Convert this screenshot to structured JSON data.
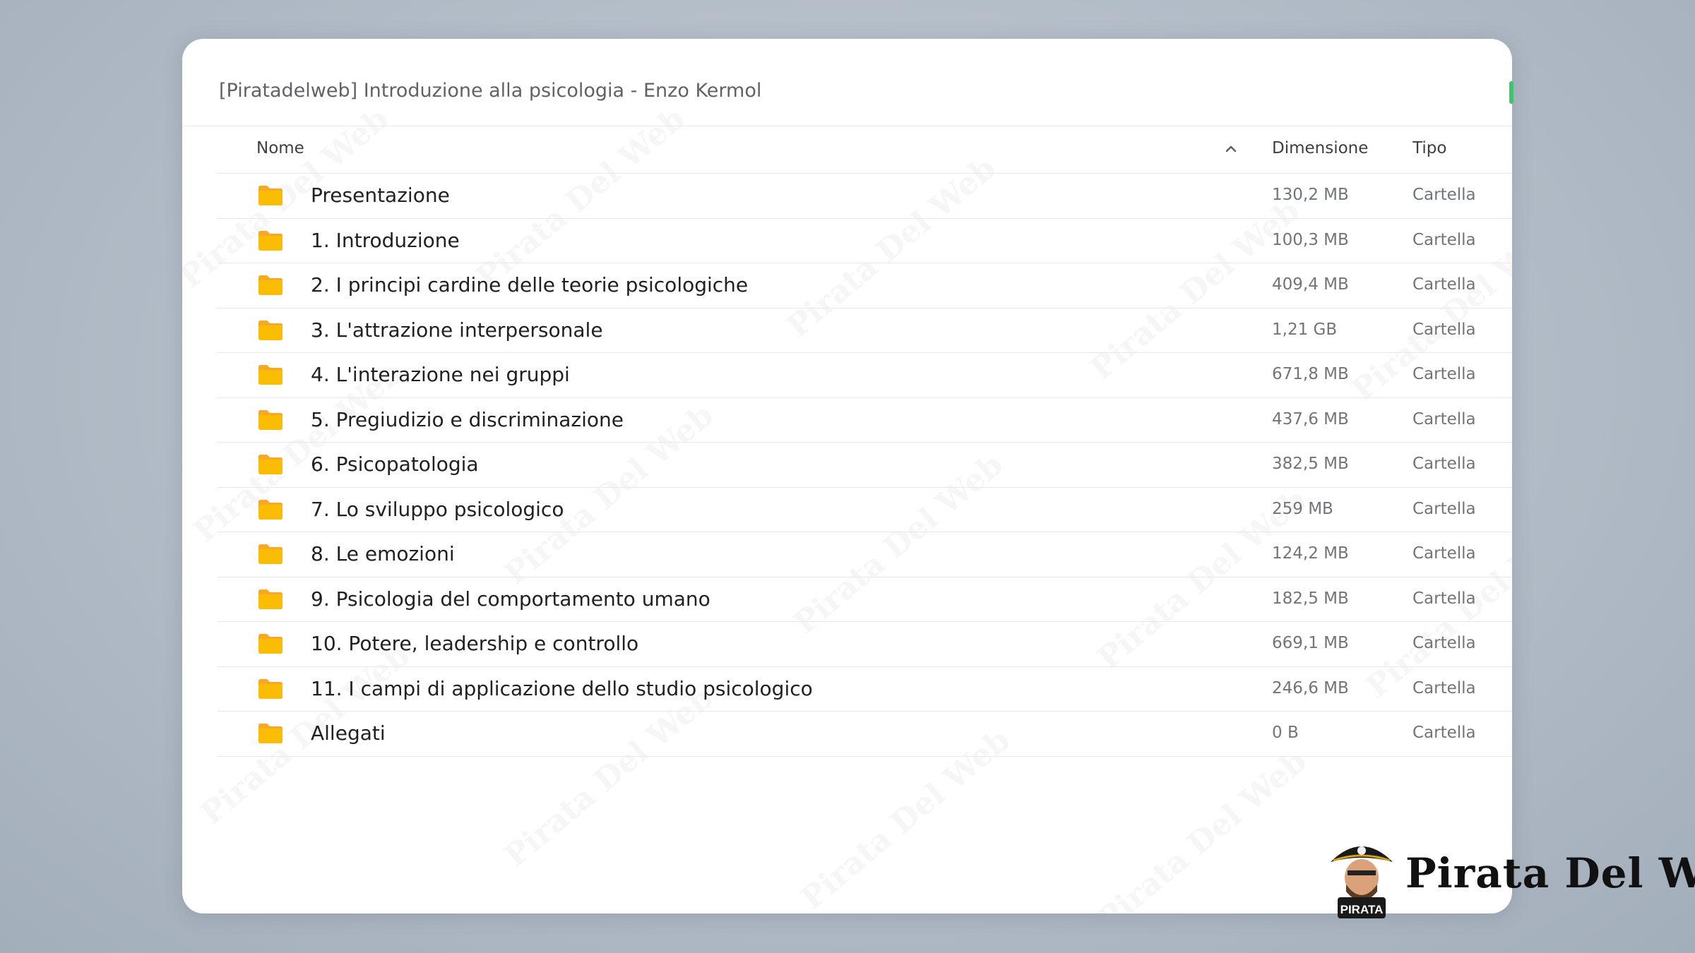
{
  "window": {
    "title": "[Piratadelweb] Introduzione alla psicologia - Enzo Kermol"
  },
  "columns": {
    "name": "Nome",
    "size": "Dimensione",
    "type": "Tipo",
    "sort_icon": "chevron-up-icon"
  },
  "files": [
    {
      "name": "Presentazione",
      "size": "130,2 MB",
      "type": "Cartella"
    },
    {
      "name": "1. Introduzione",
      "size": "100,3 MB",
      "type": "Cartella"
    },
    {
      "name": "2. I principi cardine delle teorie psicologiche",
      "size": "409,4 MB",
      "type": "Cartella"
    },
    {
      "name": "3. L'attrazione interpersonale",
      "size": "1,21 GB",
      "type": "Cartella"
    },
    {
      "name": "4. L'interazione nei gruppi",
      "size": "671,8 MB",
      "type": "Cartella"
    },
    {
      "name": "5. Pregiudizio e discriminazione",
      "size": "437,6 MB",
      "type": "Cartella"
    },
    {
      "name": "6. Psicopatologia",
      "size": "382,5 MB",
      "type": "Cartella"
    },
    {
      "name": "7. Lo sviluppo psicologico",
      "size": "259 MB",
      "type": "Cartella"
    },
    {
      "name": "8. Le emozioni",
      "size": "124,2 MB",
      "type": "Cartella"
    },
    {
      "name": "9. Psicologia del comportamento umano",
      "size": "182,5 MB",
      "type": "Cartella"
    },
    {
      "name": "10. Potere, leadership e controllo",
      "size": "669,1 MB",
      "type": "Cartella"
    },
    {
      "name": "11. I campi di applicazione dello studio psicologico",
      "size": "246,6 MB",
      "type": "Cartella"
    },
    {
      "name": "Allegati",
      "size": "0 B",
      "type": "Cartella"
    }
  ],
  "branding": {
    "logo_text": "Pirata Del Web",
    "badge_text": "PIRATA",
    "watermark_text": "Pirata Del Web"
  },
  "colors": {
    "folder": "#fbbc04",
    "folder_tab": "#f9a825",
    "accent_green": "#3ec46d"
  }
}
